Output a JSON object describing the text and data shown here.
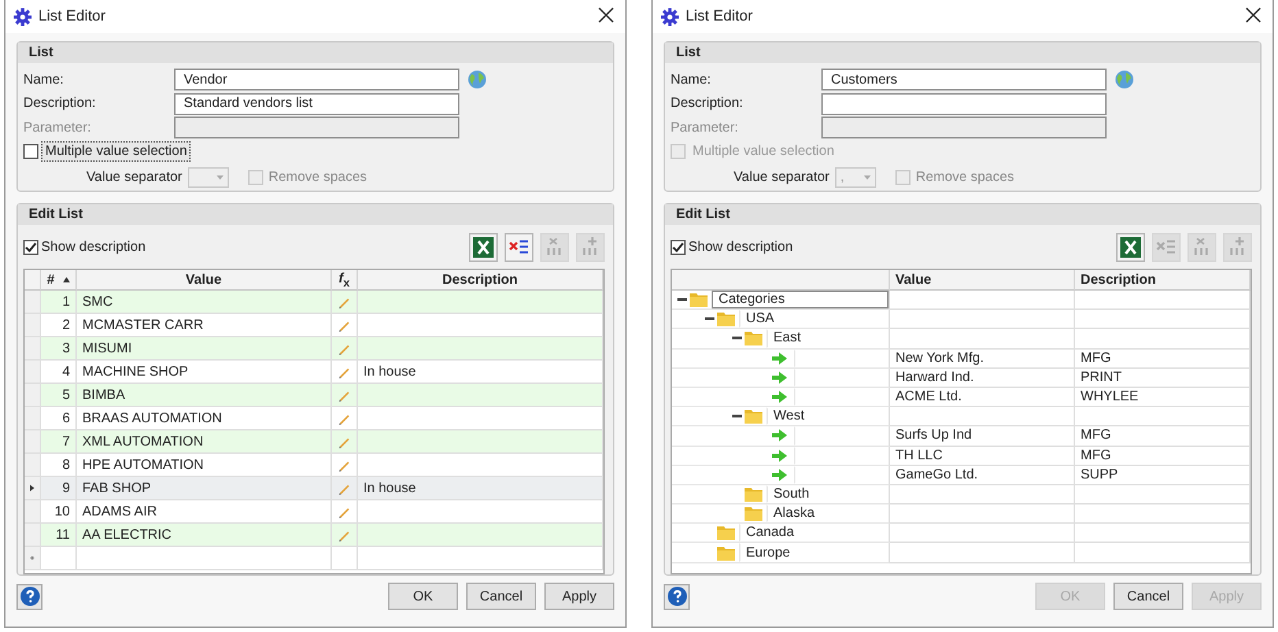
{
  "dialogs": [
    {
      "title": "List Editor",
      "list_group": {
        "title": "List",
        "fields": [
          {
            "label": "Name:",
            "value": "Vendor",
            "disabled": false,
            "globe": true
          },
          {
            "label": "Description:",
            "value": "Standard vendors list",
            "disabled": false,
            "globe": false
          },
          {
            "label": "Parameter:",
            "disabled": true,
            "globe": false
          }
        ],
        "multiple": {
          "label": "Multiple value selection",
          "checked": false,
          "disabled": false,
          "focused": true
        },
        "separator": {
          "label": "Value separator",
          "disabled": true
        },
        "remove_spaces": {
          "label": "Remove spaces",
          "checked": false,
          "disabled": true
        }
      },
      "edit_group": {
        "title": "Edit List",
        "show_description": {
          "label": "Show description",
          "checked": true
        },
        "toolbar": [
          {
            "kind": "excel",
            "disabled": false
          },
          {
            "kind": "delete-rows",
            "disabled": false
          },
          {
            "kind": "remove-level",
            "disabled": true
          },
          {
            "kind": "add-level",
            "disabled": true
          }
        ],
        "grid": {
          "kind": "table",
          "columns": [
            {
              "label": "#",
              "sorted": true
            },
            {
              "label": "Value",
              "sorted": false
            },
            {
              "label": "*f*$_{x}$",
              "sorted": false
            },
            {
              "label": "Description",
              "sorted": false
            }
          ],
          "rows": [
            {
              "number": "1",
              "value": "SMC",
              "selected": false
            },
            {
              "number": "2",
              "value": "MCMASTER CARR",
              "selected": false
            },
            {
              "number": "3",
              "value": "MISUMI",
              "selected": false
            },
            {
              "number": "4",
              "value": "MACHINE SHOP",
              "description": "In house",
              "selected": false
            },
            {
              "number": "5",
              "value": "BIMBA",
              "selected": false
            },
            {
              "number": "6",
              "value": "BRAAS AUTOMATION",
              "selected": false
            },
            {
              "number": "7",
              "value": "XML AUTOMATION",
              "selected": false
            },
            {
              "number": "8",
              "value": "HPE AUTOMATION",
              "selected": false
            },
            {
              "number": "9",
              "value": "FAB SHOP",
              "description": "In house",
              "selected": true
            },
            {
              "number": "10",
              "value": "ADAMS AIR",
              "selected": false
            },
            {
              "number": "11",
              "value": "AA ELECTRIC",
              "selected": false
            }
          ]
        }
      },
      "buttons": [
        {
          "label": "OK",
          "disabled": false
        },
        {
          "label": "Cancel",
          "disabled": false
        },
        {
          "label": "Apply",
          "disabled": false
        }
      ]
    },
    {
      "title": "List Editor",
      "list_group": {
        "title": "List",
        "fields": [
          {
            "label": "Name:",
            "value": "Customers",
            "disabled": false,
            "globe": true
          },
          {
            "label": "Description:",
            "disabled": false,
            "globe": false
          },
          {
            "label": "Parameter:",
            "disabled": true,
            "globe": false
          }
        ],
        "multiple": {
          "label": "Multiple value selection",
          "checked": false,
          "disabled": true,
          "focused": false
        },
        "separator": {
          "label": "Value separator",
          "value": ",",
          "disabled": true
        },
        "remove_spaces": {
          "label": "Remove spaces",
          "checked": false,
          "disabled": true
        }
      },
      "edit_group": {
        "title": "Edit List",
        "show_description": {
          "label": "Show description",
          "checked": true
        },
        "toolbar": [
          {
            "kind": "excel",
            "disabled": false
          },
          {
            "kind": "delete-rows",
            "disabled": true
          },
          {
            "kind": "remove-level",
            "disabled": true
          },
          {
            "kind": "add-level",
            "disabled": true
          }
        ],
        "grid": {
          "kind": "tree",
          "columns": [
            {
              "label": "Value",
              "sorted": false
            },
            {
              "label": "Description",
              "sorted": false
            }
          ],
          "nodes": [
            {
              "kind": "folder",
              "label": "Categories",
              "expanded": true,
              "selected": true,
              "children": [
                {
                  "kind": "folder",
                  "label": "USA",
                  "expanded": true,
                  "selected": false,
                  "children": [
                    {
                      "kind": "folder",
                      "label": "East",
                      "expanded": true,
                      "selected": false,
                      "children": [
                        {
                          "kind": "item",
                          "value": "New York Mfg.",
                          "description": "MFG",
                          "selected": false
                        },
                        {
                          "kind": "item",
                          "value": "Harward Ind.",
                          "description": "PRINT",
                          "selected": false
                        },
                        {
                          "kind": "item",
                          "value": "ACME Ltd.",
                          "description": "WHYLEE",
                          "selected": false
                        }
                      ]
                    },
                    {
                      "kind": "folder",
                      "label": "West",
                      "expanded": true,
                      "selected": false,
                      "children": [
                        {
                          "kind": "item",
                          "value": "Surfs Up Ind",
                          "description": "MFG",
                          "selected": false
                        },
                        {
                          "kind": "item",
                          "value": "TH LLC",
                          "description": "MFG",
                          "selected": false
                        },
                        {
                          "kind": "item",
                          "value": "GameGo Ltd.",
                          "description": "SUPP",
                          "selected": false
                        }
                      ]
                    },
                    {
                      "kind": "folder",
                      "label": "South",
                      "selected": false
                    },
                    {
                      "kind": "folder",
                      "label": "Alaska",
                      "selected": false
                    }
                  ]
                },
                {
                  "kind": "folder",
                  "label": "Canada",
                  "selected": false
                },
                {
                  "kind": "folder",
                  "label": "Europe",
                  "selected": false
                }
              ]
            }
          ]
        }
      },
      "buttons": [
        {
          "label": "OK",
          "disabled": true
        },
        {
          "label": "Cancel",
          "disabled": false
        },
        {
          "label": "Apply",
          "disabled": true
        }
      ]
    }
  ]
}
